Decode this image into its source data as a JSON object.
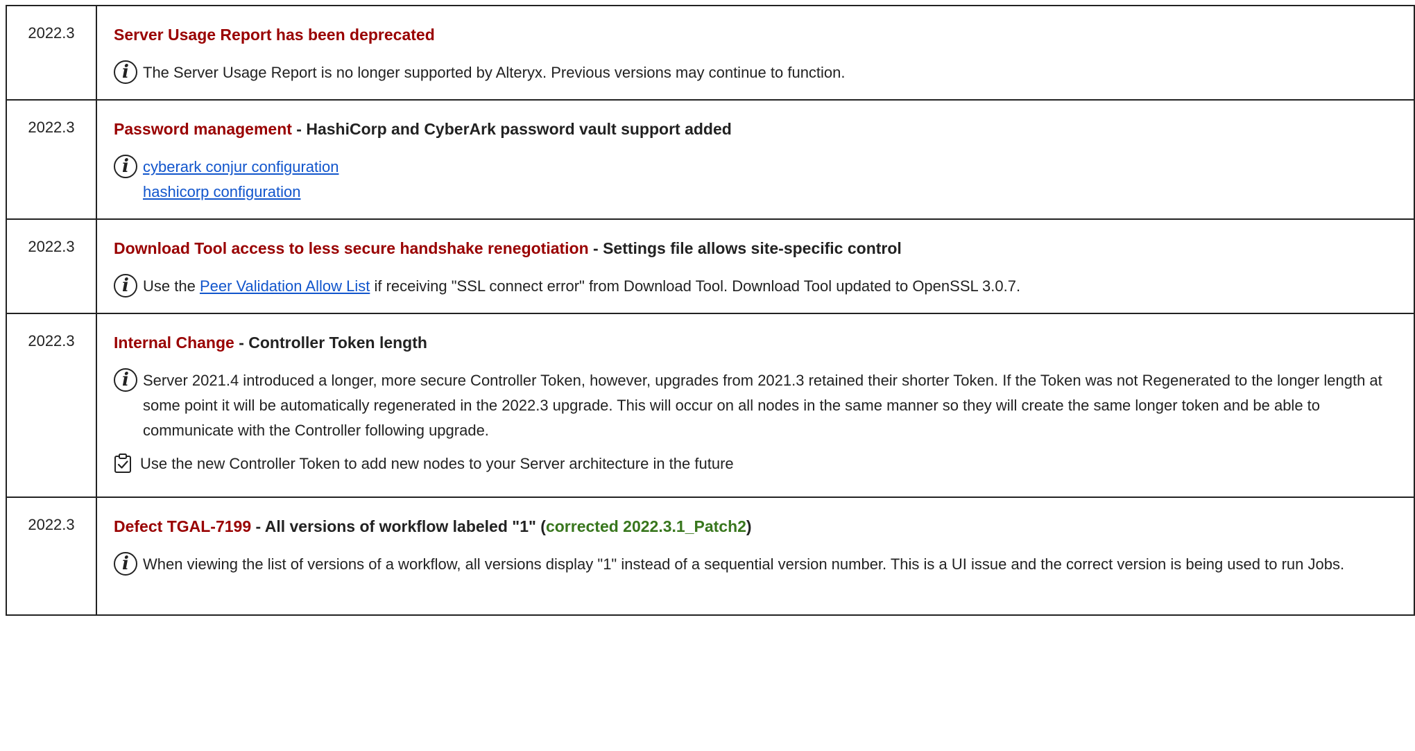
{
  "rows": [
    {
      "version": "2022.3",
      "title_red": "Server Usage Report has been deprecated",
      "note": "The Server Usage Report is no longer supported by Alteryx. Previous versions may continue to function."
    },
    {
      "version": "2022.3",
      "title_red": "Password management",
      "title_rest": " - HashiCorp and CyberArk password vault support added",
      "links": [
        "cyberark conjur configuration",
        "hashicorp configuration"
      ]
    },
    {
      "version": "2022.3",
      "title_red": "Download Tool access to less secure handshake renegotiation",
      "title_rest": " - Settings file allows site-specific control",
      "note_pre": "Use the ",
      "note_link": "Peer Validation Allow List",
      "note_post": " if receiving \"SSL connect error\" from Download Tool.  Download Tool updated to OpenSSL 3.0.7."
    },
    {
      "version": "2022.3",
      "title_red": "Internal Change",
      "title_rest": " - Controller Token length",
      "note": "Server 2021.4 introduced a longer, more secure Controller Token, however, upgrades from 2021.3 retained their shorter Token.  If the Token was not Regenerated to the longer length at some point it will be automatically regenerated in the 2022.3 upgrade.  This will occur on all nodes in the same manner so they will create the same longer token and be able to communicate with the Controller following upgrade.",
      "action": "Use the new Controller Token to add new nodes to your Server architecture in the future"
    },
    {
      "version": "2022.3",
      "title_red": "Defect TGAL-7199",
      "title_rest": " - All versions of workflow labeled \"1\" (",
      "title_green": "corrected 2022.3.1_Patch2",
      "title_end": ")",
      "note": "When viewing the list of versions of a workflow, all versions display \"1\" instead of a sequential version number.  This is a UI issue and the correct version is being used to run Jobs."
    }
  ],
  "icons": {
    "info": "info-circle-icon",
    "task": "clipboard-check-icon"
  },
  "colors": {
    "title_red": "#990000",
    "link_blue": "#1155cc",
    "patch_green": "#38761d"
  }
}
